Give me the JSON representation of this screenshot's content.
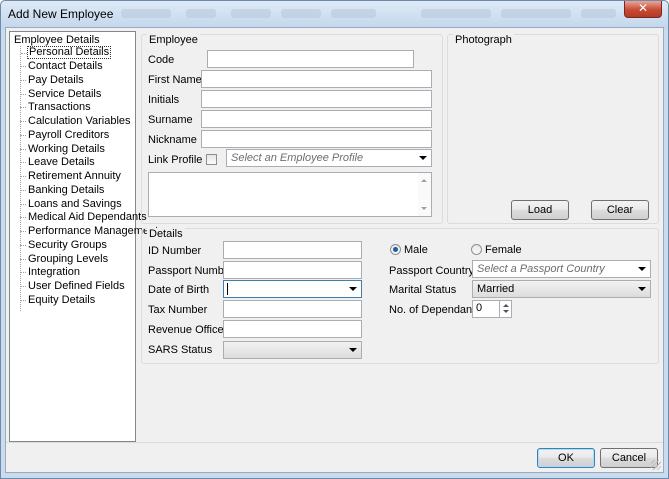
{
  "window": {
    "title": "Add New Employee",
    "close_glyph": "✕"
  },
  "tree": {
    "root": "Employee Details",
    "items": [
      "Personal Details",
      "Contact Details",
      "Pay Details",
      "Service Details",
      "Transactions",
      "Calculation Variables",
      "Payroll Creditors",
      "Working Details",
      "Leave Details",
      "Retirement Annuity",
      "Banking Details",
      "Loans and Savings",
      "Medical Aid Dependants",
      "Performance Management",
      "Security Groups",
      "Grouping Levels",
      "Integration",
      "User Defined Fields",
      "Equity Details"
    ],
    "selected_index": 0
  },
  "employee": {
    "group_title": "Employee",
    "code_label": "Code",
    "first_names_label": "First Names",
    "initials_label": "Initials",
    "surname_label": "Surname",
    "nickname_label": "Nickname",
    "link_profile_label": "Link Profile",
    "profile_placeholder": "Select an Employee Profile"
  },
  "photograph": {
    "group_title": "Photograph",
    "load_label": "Load",
    "clear_label": "Clear"
  },
  "details": {
    "group_title": "Details",
    "id_number_label": "ID Number",
    "passport_number_label": "Passport Number",
    "date_of_birth_label": "Date of Birth",
    "tax_number_label": "Tax Number",
    "revenue_office_label": "Revenue Office",
    "sars_status_label": "SARS Status",
    "male_label": "Male",
    "female_label": "Female",
    "gender_selected": "Male",
    "passport_country_label": "Passport Country",
    "passport_country_placeholder": "Select a Passport Country",
    "marital_status_label": "Marital Status",
    "marital_status_value": "Married",
    "dependants_label": "No. of Dependants",
    "dependants_value": "0"
  },
  "footer": {
    "ok_label": "OK",
    "cancel_label": "Cancel"
  }
}
